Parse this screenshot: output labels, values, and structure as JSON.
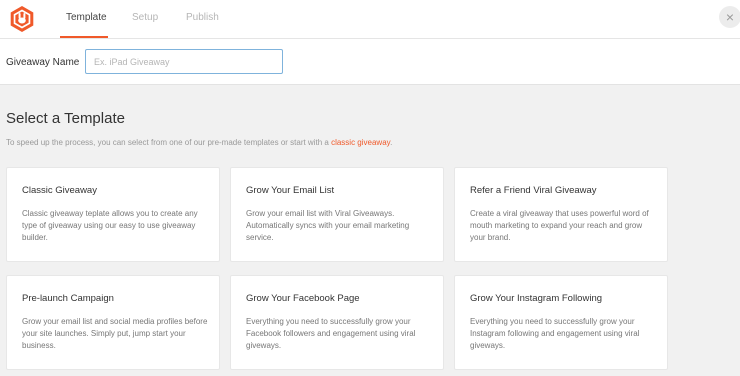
{
  "header": {
    "logo_icon": "rocket-bunny-logo",
    "tabs": [
      {
        "label": "Template",
        "active": true
      },
      {
        "label": "Setup",
        "active": false
      },
      {
        "label": "Publish",
        "active": false
      }
    ],
    "close_label": "×",
    "accent_color": "#f0592a"
  },
  "giveaway_name": {
    "label": "Giveaway Name",
    "placeholder": "Ex. iPad Giveaway",
    "value": ""
  },
  "templates_section": {
    "title": "Select a Template",
    "description_prefix": "To speed up the process, you can select from one of our pre-made templates or start with a",
    "description_link": "classic giveaway",
    "description_suffix": ".",
    "cards": [
      {
        "title": "Classic Giveaway",
        "description": "Classic giveaway teplate allows you to create any type of giveaway using our easy to use giveaway builder."
      },
      {
        "title": "Grow Your Email List",
        "description": "Grow your email list with Viral Giveaways. Automatically syncs with your email marketing service."
      },
      {
        "title": "Refer a Friend Viral Giveaway",
        "description": "Create a viral giveaway that uses powerful word of mouth marketing to expand your reach and grow your brand."
      },
      {
        "title": "Pre-launch Campaign",
        "description": "Grow your email list and social media profiles before your site launches. Simply put, jump start your business."
      },
      {
        "title": "Grow Your Facebook Page",
        "description": "Everything you need to successfully grow your Facebook followers and engagement using viral giveways."
      },
      {
        "title": "Grow Your Instagram Following",
        "description": "Everything you need to successfully grow your Instagram following and engagement using viral giveways."
      }
    ]
  }
}
